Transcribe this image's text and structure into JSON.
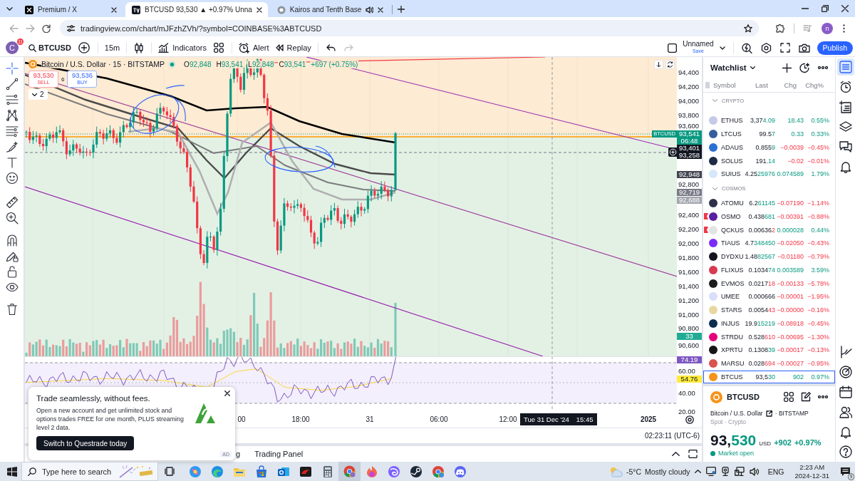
{
  "browser": {
    "tabs": [
      {
        "title": "Premium / X",
        "selected": false,
        "audio": false
      },
      {
        "title": "BTCUSD 93,530 ▲ +0.97% Unna",
        "selected": true,
        "audio": false
      },
      {
        "title": "Kairos and Tenth Base",
        "selected": false,
        "audio": true
      }
    ],
    "url": "tradingview.com/chart/mJFzhZVh/?symbol=COINBASE%3ABTCUSD",
    "profile_initial": "n"
  },
  "toolbar": {
    "avatar_initial": "C",
    "notifications": "11",
    "symbol": "BTCUSD",
    "interval": "15m",
    "indicators": "Indicators",
    "alert": "Alert",
    "replay": "Replay",
    "undo": {
      "disabled": false
    },
    "redo": {
      "disabled": true
    },
    "layout_name": "Unnamed",
    "save": "Save",
    "publish": "Publish"
  },
  "left_tools": [
    {
      "selected": true
    },
    {
      "selected": false
    },
    {
      "selected": false
    },
    {
      "selected": false
    },
    {
      "selected": false
    },
    {
      "selected": false
    },
    {
      "selected": false
    },
    {
      "selected": false
    },
    {
      "selected": false
    },
    {
      "selected": false
    },
    {
      "selected": false
    },
    {
      "selected": false
    },
    {
      "selected": false
    },
    {
      "selected": false
    },
    {
      "selected": false
    }
  ],
  "chart": {
    "legend": {
      "title": "Bitcoin / U.S. Dollar · 15 · BITSTAMP",
      "ohlc": [
        {
          "label": "O",
          "value": "92,848"
        },
        {
          "label": "H",
          "value": "93,541"
        },
        {
          "label": "L",
          "value": "92,848"
        },
        {
          "label": "C",
          "value": "93,541"
        }
      ],
      "change": "+697 (+0.75%)"
    },
    "sell": {
      "price": "93,530",
      "label": "SELL"
    },
    "spread": "6",
    "buy": {
      "price": "93,536",
      "label": "BUY"
    },
    "indicator_count": "2",
    "indicators_expanded": false,
    "price_ticks": [
      "94,400",
      "94,200",
      "94,000",
      "93,800",
      "93,600",
      "92,800",
      "92,400",
      "92,200",
      "92,000",
      "91,800",
      "91,600",
      "91,400",
      "91,200",
      "91,000",
      "90,800",
      "90,600"
    ],
    "markers": [
      {
        "lines": [
          "93,541",
          "06:48"
        ],
        "tag": "BTCUSD",
        "color": "#089981"
      },
      {
        "lines": [
          "93,401",
          "93,258"
        ],
        "color": "#131722"
      },
      {
        "lines": [
          "92,948"
        ],
        "color": "#434651"
      },
      {
        "lines": [
          "92,719"
        ],
        "color": "#787b86"
      },
      {
        "lines": [
          "92,688"
        ],
        "color": "#a3a6af"
      },
      {
        "lines": [
          "33"
        ],
        "color": "#22ab94"
      },
      {
        "lines": [
          "74.19"
        ],
        "color": "#7e57c2"
      },
      {
        "lines": [
          "54.76"
        ],
        "color": "#ffeb3b"
      }
    ],
    "rsi_ticks": [
      "60.00",
      "40.00",
      "20.00"
    ],
    "time_labels": [
      "00",
      "18:00",
      "31",
      "06:00",
      "12:00",
      "2025"
    ],
    "crosshair": {
      "date": "Tue 31 Dec '24",
      "time": "15:45"
    },
    "clock": "02:23:11 (UTC-6)"
  },
  "bottom_panel": {
    "tabs": [
      {
        "label": "g"
      },
      {
        "label": "Trading Panel"
      }
    ]
  },
  "watchlist": {
    "title": "Watchlist",
    "columns": [
      "Symbol",
      "Last",
      "Chg",
      "Chg%"
    ],
    "sections": [
      {
        "name": "CRYPTO",
        "expanded": true,
        "rows": [
          {
            "symbol": "ETHUS",
            "color": "#c5cae9",
            "last_head": "3,37",
            "last_tail": "4.09",
            "tick_up": true,
            "chg": "18.43",
            "chg_pct": "0.55%",
            "rising": true,
            "flagged": false,
            "selected": false
          },
          {
            "symbol": "LTCUS",
            "color": "#345d9d",
            "last_head": "99.5",
            "last_tail": "7",
            "tick_up": true,
            "chg": "0.33",
            "chg_pct": "0.33%",
            "rising": true,
            "flagged": false,
            "selected": false
          },
          {
            "symbol": "ADAUS",
            "color": "#2a71d0",
            "last_head": "0.855",
            "last_tail": "9",
            "tick_up": true,
            "chg": "−0.0039",
            "chg_pct": "−0.45%",
            "rising": false,
            "flagged": false,
            "selected": false
          },
          {
            "symbol": "SOLUS",
            "color": "#1f2a44",
            "last_head": "191.",
            "last_tail": "14",
            "tick_up": true,
            "chg": "−0.02",
            "chg_pct": "−0.01%",
            "rising": false,
            "flagged": false,
            "selected": false
          },
          {
            "symbol": "SUIUS",
            "color": "#d6e6fb",
            "last_head": "4.25",
            "last_tail": "25976",
            "tick_up": true,
            "chg": "0.074589",
            "chg_pct": "1.79%",
            "rising": true,
            "flagged": false,
            "selected": false
          }
        ]
      },
      {
        "name": "COSMOS",
        "expanded": true,
        "rows": [
          {
            "symbol": "ATOMU",
            "color": "#2e3148",
            "last_head": "6.2",
            "last_tail": "61145",
            "tick_up": true,
            "chg": "−0.07190",
            "chg_pct": "−1.14%",
            "rising": false,
            "flagged": false,
            "selected": false
          },
          {
            "symbol": "OSMO",
            "color": "#5c1ea0",
            "last_head": "0.438",
            "last_tail": "681",
            "tick_up": true,
            "chg": "−0.00391",
            "chg_pct": "−0.88%",
            "rising": false,
            "flagged": true,
            "selected": false
          },
          {
            "symbol": "QCKUS",
            "color": "#e3e3e3",
            "last_head": "0.00636",
            "last_tail": "2",
            "tick_up": false,
            "chg": "0.000028",
            "chg_pct": "0.44%",
            "rising": true,
            "flagged": true,
            "selected": false
          },
          {
            "symbol": "TIAUS",
            "color": "#7b2bf9",
            "last_head": "4.7",
            "last_tail": "348450",
            "tick_up": true,
            "chg": "−0.02050",
            "chg_pct": "−0.43%",
            "rising": false,
            "flagged": false,
            "selected": false
          },
          {
            "symbol": "DYDXU",
            "color": "#14141f",
            "last_head": "1.48",
            "last_tail": "82567",
            "tick_up": true,
            "chg": "−0.01180",
            "chg_pct": "−0.79%",
            "rising": false,
            "flagged": false,
            "selected": false
          },
          {
            "symbol": "FLIXUS",
            "color": "#d83a52",
            "last_head": "0.1034",
            "last_tail": "74",
            "tick_up": true,
            "chg": "0.003589",
            "chg_pct": "3.59%",
            "rising": true,
            "flagged": false,
            "selected": false
          },
          {
            "symbol": "EVMOS",
            "color": "#1c1c1c",
            "last_head": "0.0217",
            "last_tail": "18",
            "tick_up": false,
            "chg": "−0.00133",
            "chg_pct": "−5.78%",
            "rising": false,
            "flagged": false,
            "selected": false
          },
          {
            "symbol": "UMEE",
            "color": "#d9defc",
            "last_head": "0.000666",
            "chg": "−0.00001",
            "chg_pct": "−1.95%",
            "rising": false,
            "flagged": false,
            "selected": false
          },
          {
            "symbol": "STARS",
            "color": "#e9d7a0",
            "last_head": "0.0054",
            "last_tail": "43",
            "tick_up": false,
            "chg": "−0.00000",
            "chg_pct": "−0.16%",
            "rising": false,
            "flagged": false,
            "selected": false
          },
          {
            "symbol": "INJUS",
            "color": "#0b2e4f",
            "last_head": "19.9",
            "last_tail": "15219",
            "tick_up": true,
            "chg": "−0.08918",
            "chg_pct": "−0.45%",
            "rising": false,
            "flagged": false,
            "selected": false
          },
          {
            "symbol": "STRDU",
            "color": "#e5007a",
            "last_head": "0.528",
            "last_tail": "610",
            "tick_up": false,
            "chg": "−0.00695",
            "chg_pct": "−1.30%",
            "rising": false,
            "flagged": false,
            "selected": false
          },
          {
            "symbol": "XPRTU",
            "color": "#151515",
            "last_head": "0.1308",
            "last_tail": "39",
            "tick_up": true,
            "chg": "−0.00017",
            "chg_pct": "−0.13%",
            "rising": false,
            "flagged": false,
            "selected": false
          },
          {
            "symbol": "MARSU",
            "color": "#d9534f",
            "last_head": "0.028",
            "last_tail": "694",
            "tick_up": false,
            "chg": "−0.00027",
            "chg_pct": "−0.95%",
            "rising": false,
            "flagged": false,
            "selected": false
          },
          {
            "symbol": "BTCUS",
            "color": "#f7931a",
            "last_head": "93,5",
            "last_tail": "30",
            "tick_up": true,
            "chg": "902",
            "chg_pct": "0.97%",
            "rising": true,
            "flagged": false,
            "selected": true
          }
        ]
      }
    ]
  },
  "symbol_details": {
    "symbol": "BTCUSD",
    "name": "Bitcoin / U.S. Dollar",
    "exchange": "· BITSTAMP",
    "category": "Spot · Crypto",
    "price_head": "93,",
    "price_tail": "530",
    "currency": "USD",
    "change": "+902",
    "change_pct": "+0.97%",
    "rising": true,
    "status": "Market open",
    "market_open": true
  },
  "right_sidebar": [
    {
      "selected": true
    },
    {
      "selected": false
    },
    {
      "selected": false
    },
    {
      "selected": false
    },
    {
      "selected": false
    },
    {
      "selected": false
    },
    {
      "selected": false
    },
    {
      "selected": false
    },
    {
      "selected": false
    },
    {
      "selected": false
    },
    {
      "selected": false
    },
    {
      "selected": false
    }
  ],
  "ad": {
    "title": "Trade seamlessly, without fees.",
    "body": "Open a new account and get unlimited stock and options trades FREE for one month, PLUS streaming level 2 data.",
    "button": "Switch to Questrade today",
    "badge": "AD"
  },
  "taskbar": {
    "search_placeholder": "Type here to search",
    "apps": [
      {
        "selected": false
      },
      {
        "selected": false
      },
      {
        "selected": false
      },
      {
        "selected": false
      },
      {
        "selected": false
      },
      {
        "selected": false
      },
      {
        "selected": false
      },
      {
        "selected": true
      },
      {
        "selected": false
      },
      {
        "selected": false
      },
      {
        "selected": false
      },
      {
        "selected": false
      },
      {
        "selected": false
      }
    ],
    "temperature": "-5°C",
    "weather": "Mostly cloudy",
    "language": "ENG",
    "time": "2:23 AM",
    "date": "2024-12-31",
    "notifications": "9"
  }
}
